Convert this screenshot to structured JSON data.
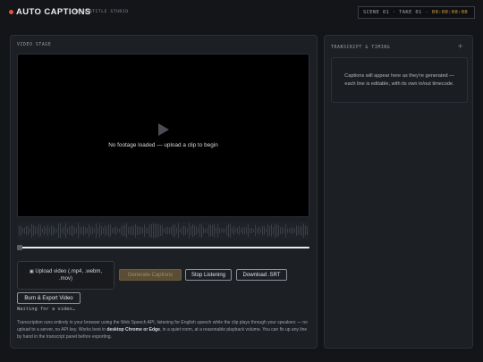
{
  "header": {
    "title": "AUTO CAPTIONS",
    "subtitle": "AI SUBTITLE STUDIO",
    "slate_scene_take": "SCENE 01 · TAKE 01 ·",
    "timecode": "00:00:00:00"
  },
  "stage": {
    "label": "VIDEO STAGE",
    "placeholder": "No footage loaded — upload a clip to begin",
    "scrub_progress": 0.0
  },
  "controls": {
    "upload_label": "Upload video (.mp4, .webm, .mov)",
    "generate_label": "Generate Captions",
    "stop_label": "Stop Listening",
    "download_label": "Download .SRT",
    "burn_label": "Burn & Export Video",
    "status": "Waiting for a video…",
    "note_before": "Transcription runs entirely in your browser using the Web Speech API, listening for English speech while the clip plays through your speakers — no upload to a server, no API key. Works best in ",
    "note_bold": "desktop Chrome or Edge",
    "note_after": ", in a quiet room, at a reasonable playback volume. You can fix up any line by hand in the transcript panel before exporting."
  },
  "transcript": {
    "label": "TRANSCRIPT & TIMING",
    "empty_message": "Captions will appear here as they're generated — each line is editable, with its own in/out timecode."
  },
  "icons": {
    "logo": "record-dot-icon",
    "play": "play-icon",
    "upload": "film-icon",
    "add": "plus-icon"
  },
  "colors": {
    "accent": "#e0a83a",
    "record": "#e2553f",
    "background": "#131519",
    "panel": "#1c1f24"
  }
}
